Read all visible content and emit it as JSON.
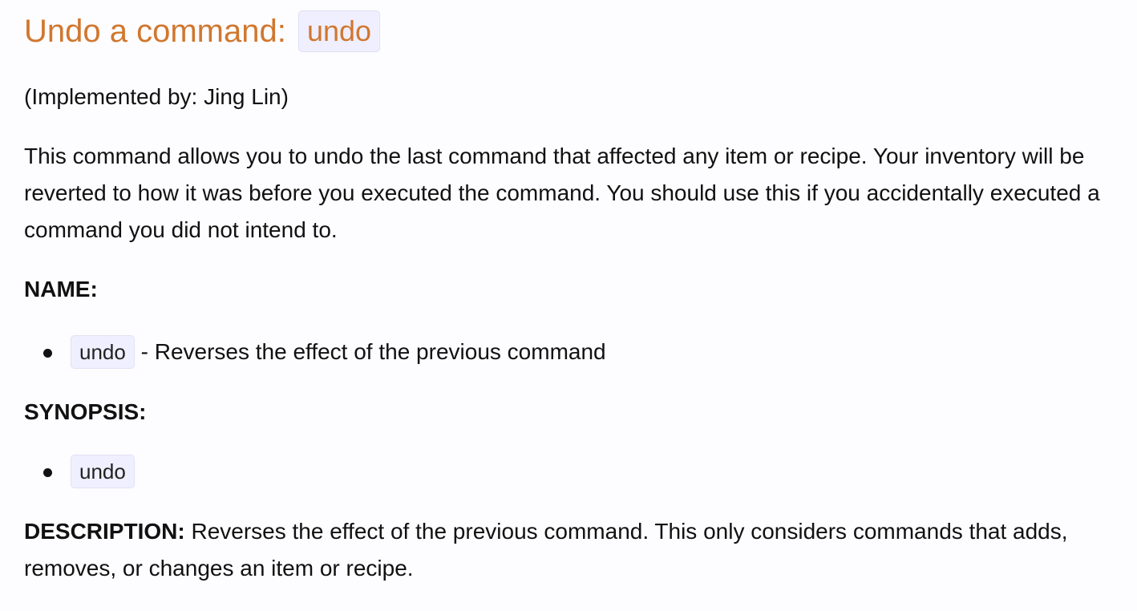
{
  "heading": {
    "text": "Undo a command:",
    "code": "undo"
  },
  "implemented_by": "(Implemented by: Jing Lin)",
  "intro": "This command allows you to undo the last command that affected any item or recipe. Your inventory will be reverted to how it was before you executed the command. You should use this if you accidentally executed a command you did not intend to.",
  "name_section": {
    "label": "NAME:",
    "items": [
      {
        "code": "undo",
        "text": " - Reverses the effect of the previous command"
      }
    ]
  },
  "synopsis_section": {
    "label": "SYNOPSIS:",
    "items": [
      {
        "code": "undo"
      }
    ]
  },
  "description_section": {
    "label": "DESCRIPTION:",
    "text": " Reverses the effect of the previous command. This only considers commands that adds, removes, or changes an item or recipe."
  },
  "colors": {
    "heading": "#d0772f",
    "code_background": "#efefff",
    "page_background": "#fdfcfe",
    "text": "#111111"
  }
}
